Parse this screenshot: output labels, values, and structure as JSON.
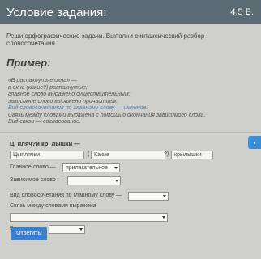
{
  "header": {
    "title": "Условие задания:",
    "points": "4,5 Б."
  },
  "task": {
    "text": "Реши орфографические задачи. Выполни синтаксический разбор словосочетания."
  },
  "example": {
    "title": "Пример:",
    "lines": [
      "«В распахнутые окна» —",
      "в окна (какие?) распахнутые;",
      "главное слово выражено существительным;",
      "зависимое слово выражено причастием.",
      "Вид словосочетания по главному слову — именное.",
      "Связь между словами выражена с помощью окончания зависимого слова.",
      "Вид связи — согласование."
    ]
  },
  "exercise": {
    "formula": "Ц_пляч?и кр_лышки —",
    "word1": "Цыплячьи",
    "paren_open": "(",
    "question_value": "Какие",
    "paren_close": "?)",
    "word2": "крылышки",
    "main_word_label": "Главное слово —",
    "main_word_value": "прилагательное",
    "dependent_word_label": "Зависимое слово —",
    "dependent_word_value": "",
    "type_label": "Вид словосочетания по главному слову —",
    "type_value": "",
    "connection_expr_label": "Связь между словами выражена",
    "connection_expr_value": "",
    "connection_type_label": "Вид связи —",
    "connection_type_value": "",
    "answer_button": "Ответить!"
  },
  "side_button": {
    "icon": "chevron-left-icon"
  },
  "colors": {
    "header": "#5b6b73",
    "button": "#3a7fd0",
    "highlight": "#5b7fa8"
  }
}
